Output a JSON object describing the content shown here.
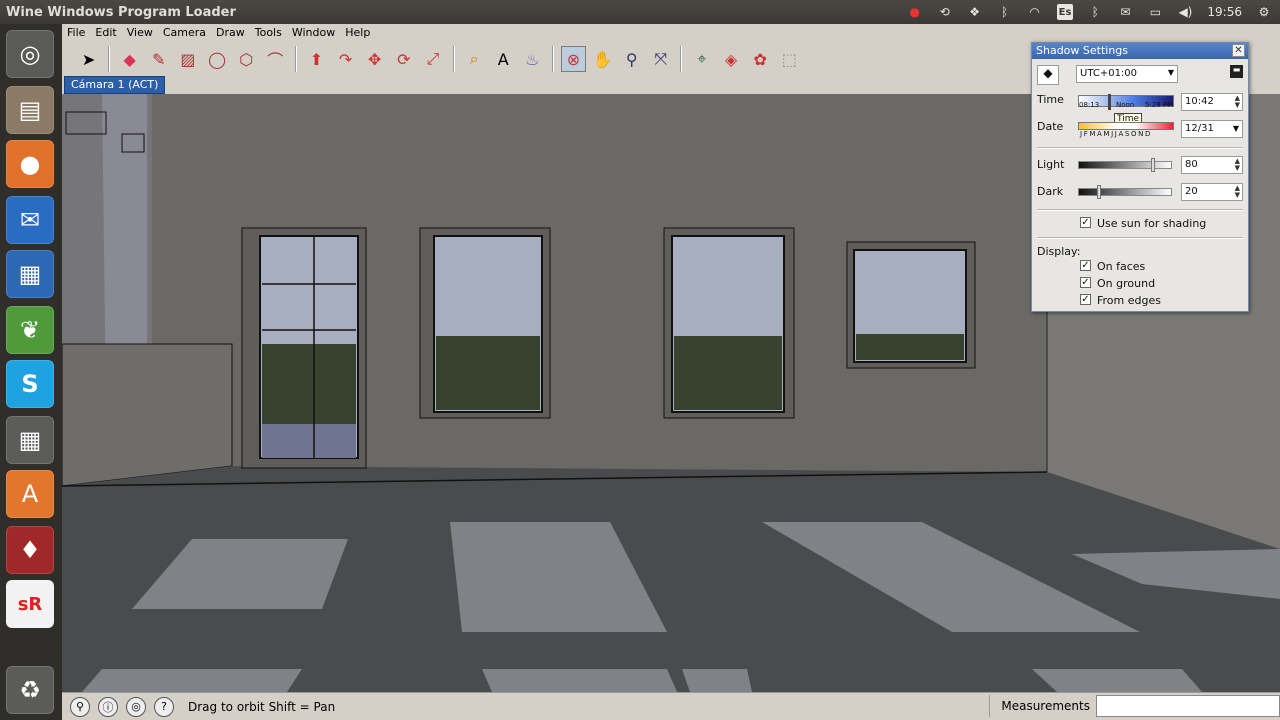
{
  "window_title": "Wine Windows Program Loader",
  "tray": {
    "time": "19:56",
    "keyboard": "Es"
  },
  "menu": [
    "File",
    "Edit",
    "View",
    "Camera",
    "Draw",
    "Tools",
    "Window",
    "Help"
  ],
  "toolbar": {
    "tools": [
      "select-icon",
      "eraser-icon",
      "pencil-icon",
      "rectangle-icon",
      "circle-icon",
      "polygon-icon",
      "arc-icon",
      "push-pull-icon",
      "follow-me-icon",
      "move-icon",
      "rotate-icon",
      "scale-icon",
      "tape-measure-icon",
      "text-icon",
      "paint-bucket-icon",
      "orbit-icon",
      "pan-icon",
      "zoom-icon",
      "zoom-extents-icon",
      "walk-icon",
      "section-icon",
      "component-icon",
      "outliner-icon"
    ],
    "active_tool": "orbit-icon"
  },
  "scene_tab": "Cámara 1 (ACT)",
  "status": {
    "text": "Drag to orbit  Shift = Pan",
    "measurements_label": "Measurements"
  },
  "shadow_dialog": {
    "title": "Shadow Settings",
    "timezone": "UTC+01:00",
    "time_label": "Time",
    "time_value": "10:42",
    "time_start": "08:13",
    "time_noon": "Noon",
    "time_end": "5:28 PM",
    "time_tooltip": "Time",
    "date_label": "Date",
    "date_value": "12/31",
    "months": "J F M A M J J A S O N D",
    "light_label": "Light",
    "light_value": "80",
    "dark_label": "Dark",
    "dark_value": "20",
    "use_sun_label": "Use sun for shading",
    "display_label": "Display:",
    "on_faces_label": "On faces",
    "on_ground_label": "On ground",
    "from_edges_label": "From edges",
    "time_fraction": 0.31,
    "light_fraction": 0.8,
    "dark_fraction": 0.2
  },
  "launcher": [
    "ubuntu-dash-icon",
    "files-icon",
    "firefox-icon",
    "thunderbird-icon",
    "writer-icon",
    "evernote-icon",
    "skype-icon",
    "calculator-icon",
    "software-center-icon",
    "wine-icon",
    "ssr-icon",
    "trash-icon"
  ]
}
